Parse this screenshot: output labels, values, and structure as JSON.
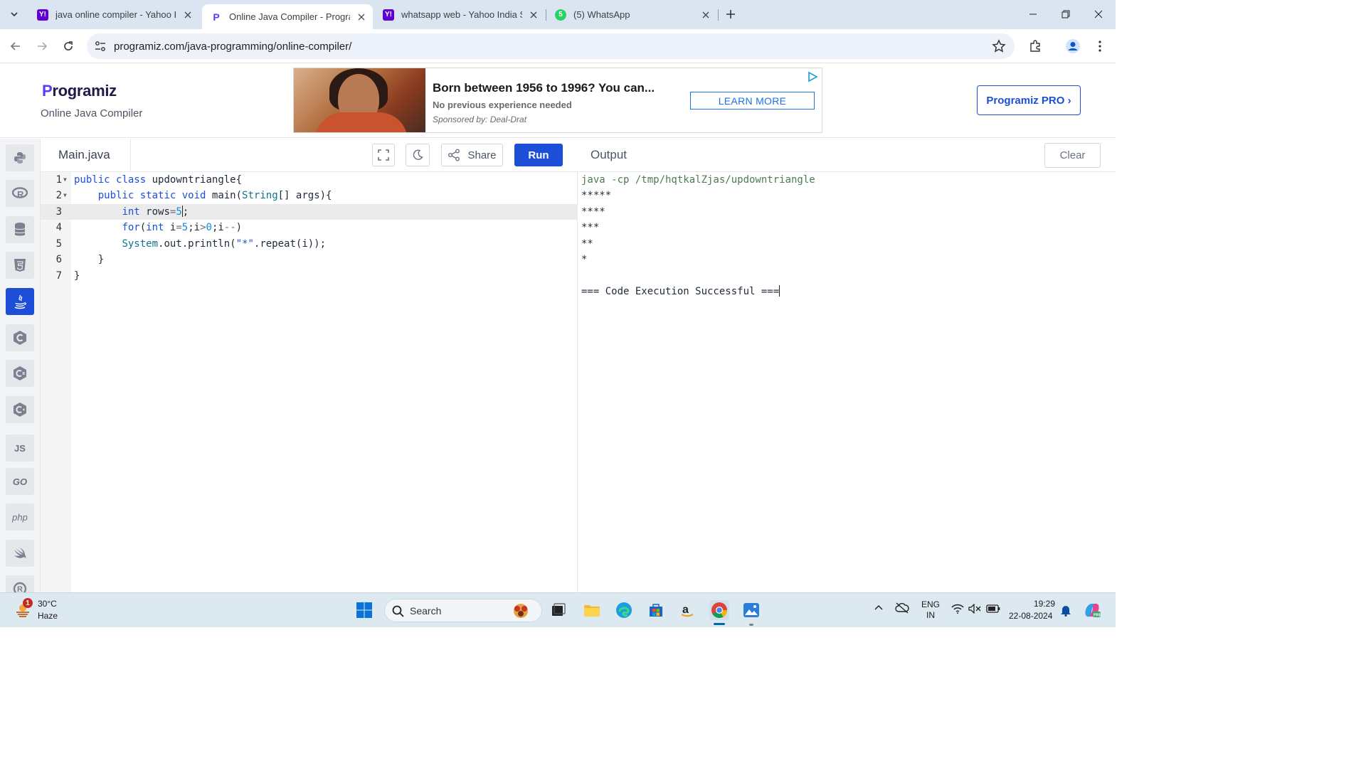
{
  "browser": {
    "tabs": [
      {
        "title": "java online compiler - Yahoo India Search Results",
        "favicon": "Y!"
      },
      {
        "title": "Online Java Compiler - Programiz",
        "favicon": "P"
      },
      {
        "title": "whatsapp web - Yahoo India Search Results",
        "favicon": "Y!"
      },
      {
        "title": "(5) WhatsApp",
        "favicon": "5"
      }
    ],
    "url": "programiz.com/java-programming/online-compiler/"
  },
  "site": {
    "logo": "Programiz",
    "logo_first_letter": "P",
    "logo_rest": "rogramiz",
    "subtitle": "Online Java Compiler",
    "pro_button": "Programiz PRO ›"
  },
  "ad": {
    "title": "Born between 1956 to 1996? You can...",
    "description": "No previous experience needed",
    "sponsor": "Sponsored by: Deal-Drat",
    "button": "LEARN MORE"
  },
  "rail": {
    "items": [
      "python-icon",
      "r-icon",
      "sql-icon",
      "html-icon",
      "java-icon",
      "c-icon",
      "csharp-icon",
      "cpp-icon",
      "JS",
      "GO",
      "php",
      "swift-icon",
      "rust-icon"
    ],
    "active_index": 4
  },
  "editor": {
    "filename": "Main.java",
    "share_label": "Share",
    "run_label": "Run",
    "active_line": 3,
    "lines": [
      {
        "n": "1",
        "text": "public class updowntriangle{"
      },
      {
        "n": "2",
        "text": "    public static void main(String[] args){"
      },
      {
        "n": "3",
        "text": "        int rows=5;"
      },
      {
        "n": "4",
        "text": "        for(int i=5;i>0;i--)"
      },
      {
        "n": "5",
        "text": "        System.out.println(\"*\".repeat(i));"
      },
      {
        "n": "6",
        "text": "    }"
      },
      {
        "n": "7",
        "text": "}"
      }
    ]
  },
  "output": {
    "title": "Output",
    "clear_label": "Clear",
    "lines": [
      "java -cp /tmp/hqtkalZjas/updowntriangle",
      "*****",
      "****",
      "***",
      "**",
      "*",
      "",
      "=== Code Execution Successful ==="
    ]
  },
  "taskbar": {
    "weather_temp": "30°C",
    "weather_desc": "Haze",
    "weather_badge": "1",
    "search_label": "Search",
    "lang_top": "ENG",
    "lang_bottom": "IN",
    "time": "19:29",
    "date": "22-08-2024"
  },
  "colors": {
    "accent": "#1d4ed8",
    "tabstrip": "#dbe4f1",
    "taskbar": "#dde9f0"
  }
}
